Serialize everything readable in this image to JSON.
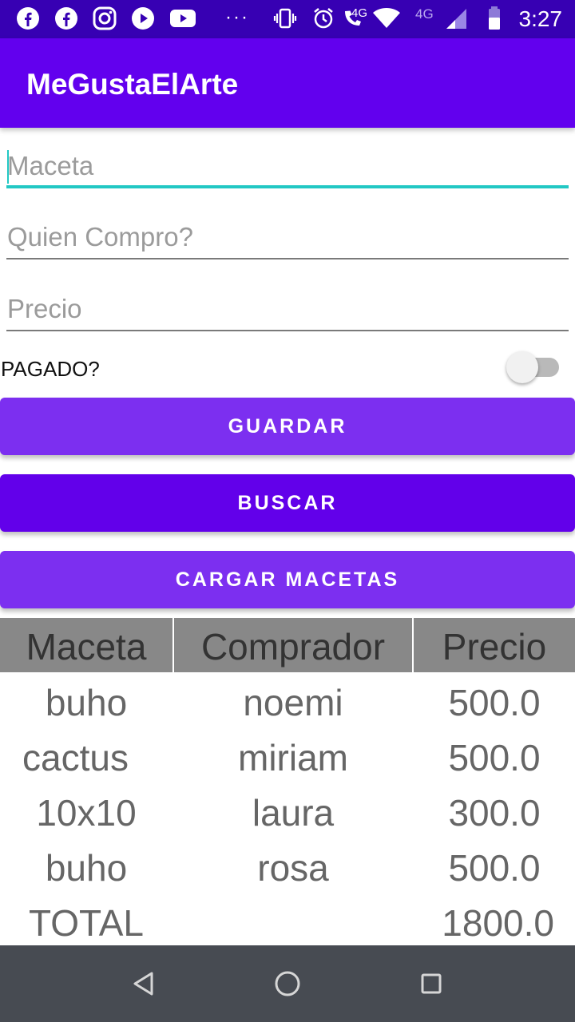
{
  "status_bar": {
    "time": "3:27",
    "network_label_1": "4G",
    "network_label_2": "4G",
    "icons": [
      "facebook-icon",
      "facebook-icon",
      "instagram-icon",
      "play-icon",
      "youtube-icon",
      "more-dots-icon",
      "vibrate-icon",
      "alarm-icon",
      "wifi-call-icon",
      "wifi-icon",
      "signal-icon",
      "battery-icon"
    ],
    "more": "···"
  },
  "app_bar": {
    "title": "MeGustaElArte"
  },
  "form": {
    "maceta_placeholder": "Maceta",
    "comprador_placeholder": "Quien Compro?",
    "precio_placeholder": "Precio",
    "pagado_label": "PAGADO?",
    "pagado_on": false
  },
  "buttons": {
    "guardar": "GUARDAR",
    "buscar": "BUSCAR",
    "cargar": "CARGAR MACETAS"
  },
  "table": {
    "headers": [
      "Maceta",
      "Comprador",
      "Precio"
    ],
    "rows": [
      [
        "buho",
        "noemi",
        "500.0"
      ],
      [
        "cactus",
        "miriam",
        "500.0"
      ],
      [
        "10x10",
        "laura",
        "300.0"
      ],
      [
        "buho",
        "rosa",
        "500.0"
      ]
    ],
    "total_label": "TOTAL",
    "total_value": "1800.0"
  },
  "colors": {
    "status_bar": "#3700b3",
    "app_bar": "#6200ee",
    "accent": "#22c8c4",
    "button_light": "#7c2ff0",
    "button_dark": "#6200ea",
    "table_header": "#888888",
    "nav_bar": "#474b52"
  }
}
